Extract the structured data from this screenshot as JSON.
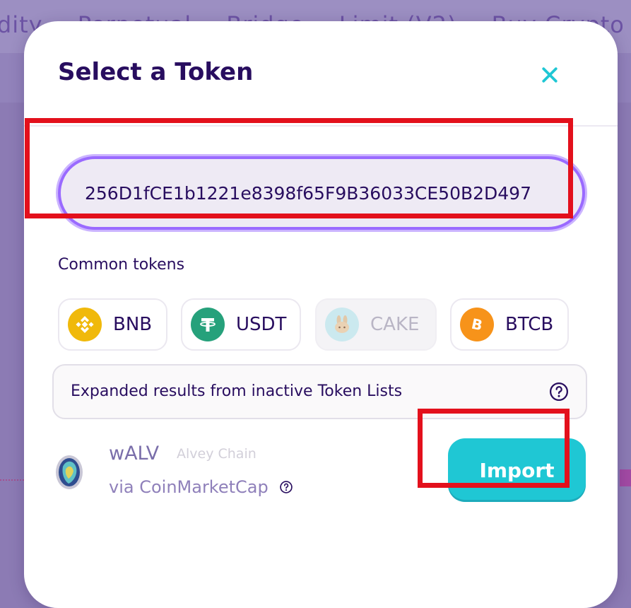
{
  "background": {
    "nav_items": [
      "idity",
      "Perpetual",
      "Bridge",
      "Limit (V2)",
      "Buy Crypto"
    ]
  },
  "modal": {
    "title": "Select a Token",
    "close_icon": "close-icon"
  },
  "search": {
    "value": "256D1fCE1b1221e8398f65F9B36033CE50B2D497"
  },
  "common_tokens": {
    "label": "Common tokens",
    "items": [
      {
        "symbol": "BNB",
        "icon": "bnb-icon",
        "color": "#f0b90b",
        "disabled": false
      },
      {
        "symbol": "USDT",
        "icon": "usdt-icon",
        "color": "#26a17b",
        "disabled": false
      },
      {
        "symbol": "CAKE",
        "icon": "cake-icon",
        "color": "#d1884f",
        "disabled": true
      },
      {
        "symbol": "BTCB",
        "icon": "btcb-icon",
        "color": "#f7931a",
        "disabled": false
      }
    ]
  },
  "inactive_lists": {
    "text": "Expanded results from inactive Token Lists"
  },
  "result": {
    "symbol": "wALV",
    "name": "Alvey Chain",
    "source": "via CoinMarketCap",
    "import_label": "Import"
  },
  "colors": {
    "primary": "#1fc7d4",
    "text": "#280d5f",
    "highlight": "#e3101c",
    "focus": "#9a6aff"
  }
}
